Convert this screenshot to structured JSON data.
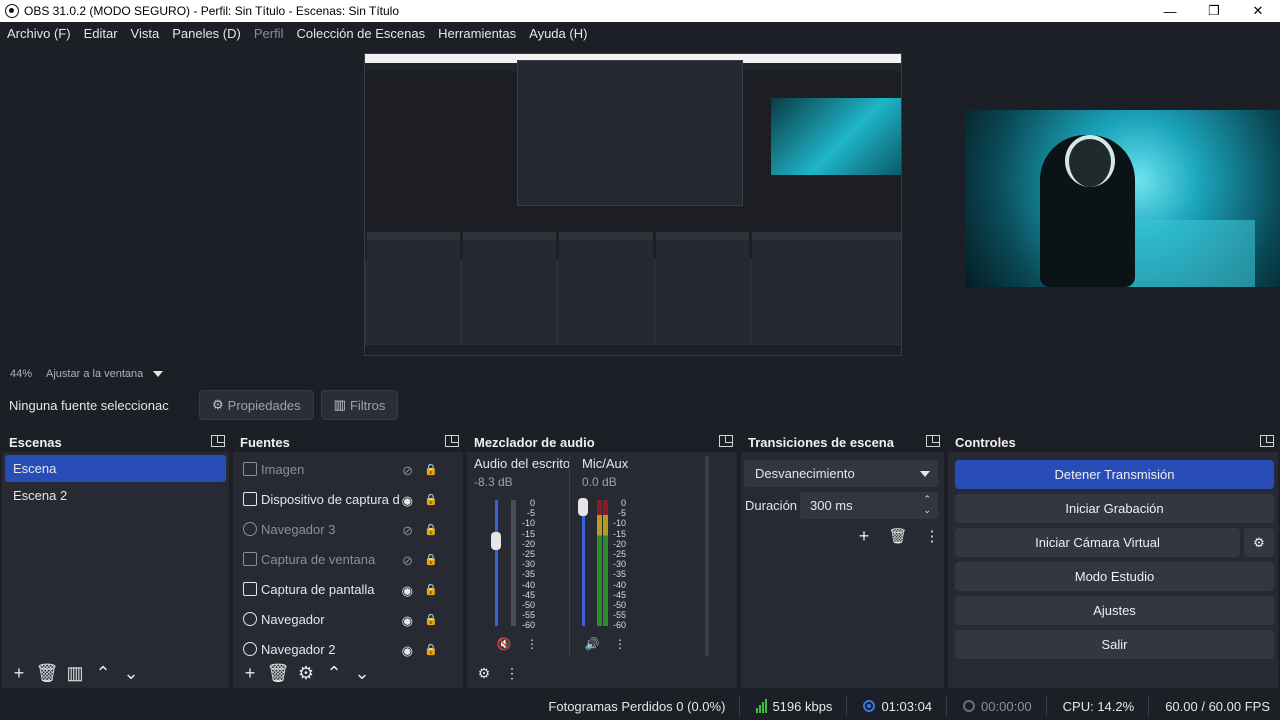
{
  "window": {
    "title": "OBS 31.0.2 (MODO SEGURO) - Perfil: Sin Título - Escenas: Sin Título",
    "minimize": "—",
    "maximize": "❐",
    "close": "✕"
  },
  "menu": [
    "Archivo (F)",
    "Editar",
    "Vista",
    "Paneles (D)",
    "Perfil",
    "Colección de Escenas",
    "Herramientas",
    "Ayuda (H)"
  ],
  "zoom": {
    "level": "44%",
    "mode": "Ajustar a la ventana"
  },
  "source_bar": {
    "no_selection": "Ninguna fuente seleccionac",
    "properties": "Propiedades",
    "filters": "Filtros"
  },
  "scenes": {
    "title": "Escenas",
    "items": [
      "Escena",
      "Escena 2"
    ],
    "active_index": 0
  },
  "sources": {
    "title": "Fuentes",
    "items": [
      {
        "label": "Imagen",
        "visible": false
      },
      {
        "label": "Dispositivo de captura d",
        "visible": true
      },
      {
        "label": "Navegador 3",
        "visible": false
      },
      {
        "label": "Captura de ventana",
        "visible": false
      },
      {
        "label": "Captura de pantalla",
        "visible": true
      },
      {
        "label": "Navegador",
        "visible": true
      },
      {
        "label": "Navegador 2",
        "visible": true
      }
    ]
  },
  "mixer": {
    "title": "Mezclador de audio",
    "channels": [
      {
        "name": "Audio del escrito",
        "db": "-8.3 dB",
        "muted": true
      },
      {
        "name": "Mic/Aux",
        "db": "0.0 dB",
        "muted": false
      }
    ],
    "ticks": [
      "0",
      "-5",
      "-10",
      "-15",
      "-20",
      "-25",
      "-30",
      "-35",
      "-40",
      "-45",
      "-50",
      "-55",
      "-60"
    ]
  },
  "transitions": {
    "title": "Transiciones de escena",
    "selected": "Desvanecimiento",
    "duration_label": "Duración",
    "duration_value": "300 ms"
  },
  "controls": {
    "title": "Controles",
    "stop_stream": "Detener Transmisión",
    "start_recording": "Iniciar Grabación",
    "start_virtual_cam": "Iniciar Cámara Virtual",
    "studio_mode": "Modo Estudio",
    "settings": "Ajustes",
    "exit": "Salir"
  },
  "status": {
    "dropped_frames": "Fotogramas Perdidos 0 (0.0%)",
    "bitrate": "5196 kbps",
    "stream_time": "01:03:04",
    "record_time": "00:00:00",
    "cpu": "CPU: 14.2%",
    "fps": "60.00 / 60.00 FPS"
  },
  "colors": {
    "accent": "#284cb8",
    "background": "#1d1f26",
    "panel": "#272a32"
  }
}
